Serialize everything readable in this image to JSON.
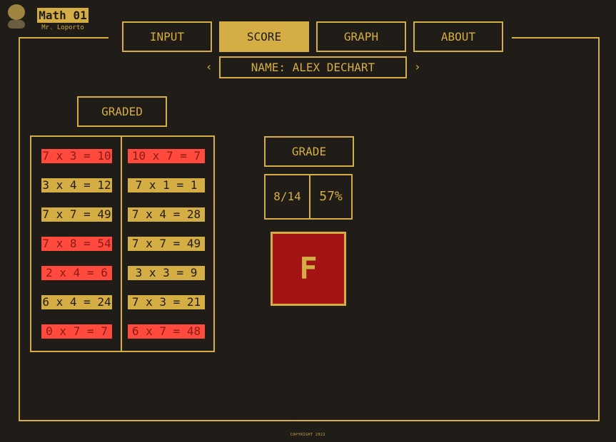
{
  "brand": {
    "title": "Math 01",
    "subtitle": "Mr. Loporto"
  },
  "tabs": [
    {
      "label": "INPUT",
      "active": false
    },
    {
      "label": "SCORE",
      "active": true
    },
    {
      "label": "GRAPH",
      "active": false
    },
    {
      "label": "ABOUT",
      "active": false
    }
  ],
  "student": {
    "name_label": "NAME:  ALEX DECHART",
    "prev_arrow": "‹",
    "next_arrow": "›"
  },
  "graded_label": "GRADED",
  "results": {
    "left": [
      {
        "text": "7 x 3 = 10",
        "correct": false
      },
      {
        "text": "3 x 4 = 12",
        "correct": true
      },
      {
        "text": "7 x 7 = 49",
        "correct": true
      },
      {
        "text": "7 x 8 = 54",
        "correct": false
      },
      {
        "text": "2 x 4 = 6",
        "correct": false
      },
      {
        "text": "6 x 4 = 24",
        "correct": true
      },
      {
        "text": "0 x 7 = 7",
        "correct": false
      }
    ],
    "right": [
      {
        "text": "10 x 7 = 7",
        "correct": false
      },
      {
        "text": "7 x 1 = 1",
        "correct": true
      },
      {
        "text": "7 x 4 = 28",
        "correct": true
      },
      {
        "text": "7 x 7 = 49",
        "correct": true
      },
      {
        "text": "3 x 3 = 9",
        "correct": true
      },
      {
        "text": "7 x 3 = 21",
        "correct": true
      },
      {
        "text": "6 x 7 = 48",
        "correct": false
      }
    ]
  },
  "grade": {
    "label": "GRADE",
    "fraction": "8/14",
    "percent": "57%",
    "letter": "F"
  },
  "colors": {
    "background": "#201c17",
    "gold": "#d4ad45",
    "wrong": "#ff4a3d",
    "grade_fail": "#a21414"
  },
  "footer": {
    "copyright": "COPYRIGHT 2022"
  }
}
